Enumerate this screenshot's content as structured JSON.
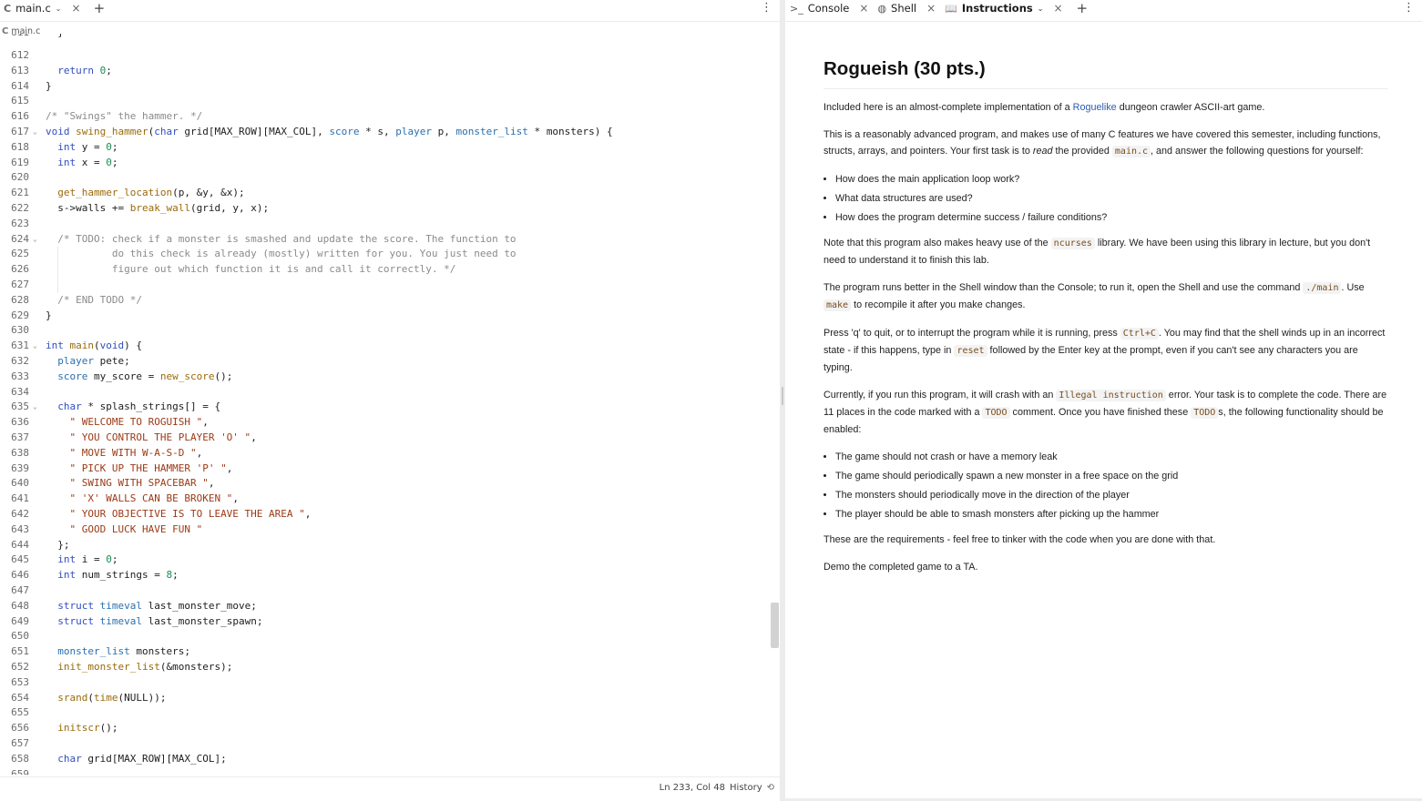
{
  "editor": {
    "tab_label": "main.c",
    "breadcrumb": "main.c",
    "status_position": "Ln 233, Col 48",
    "history_label": "History",
    "partial_line_top": "611",
    "partial_line_bottom": "659",
    "lines": [
      {
        "n": "612",
        "fold": "",
        "text": ""
      },
      {
        "n": "613",
        "fold": "",
        "text": "  return 0;"
      },
      {
        "n": "614",
        "fold": "",
        "text": "}"
      },
      {
        "n": "615",
        "fold": "",
        "text": ""
      },
      {
        "n": "616",
        "fold": "",
        "text": "/* \"Swings\" the hammer. */"
      },
      {
        "n": "617",
        "fold": "v",
        "text": "void swing_hammer(char grid[MAX_ROW][MAX_COL], score * s, player p, monster_list * monsters) {"
      },
      {
        "n": "618",
        "fold": "",
        "text": "  int y = 0;"
      },
      {
        "n": "619",
        "fold": "",
        "text": "  int x = 0;"
      },
      {
        "n": "620",
        "fold": "",
        "text": ""
      },
      {
        "n": "621",
        "fold": "",
        "text": "  get_hammer_location(p, &y, &x);"
      },
      {
        "n": "622",
        "fold": "",
        "text": "  s->walls += break_wall(grid, y, x);"
      },
      {
        "n": "623",
        "fold": "",
        "text": ""
      },
      {
        "n": "624",
        "fold": "v",
        "text": "  /* TODO: check if a monster is smashed and update the score. The function to"
      },
      {
        "n": "625",
        "fold": "",
        "text": "           do this check is already (mostly) written for you. You just need to"
      },
      {
        "n": "626",
        "fold": "",
        "text": "           figure out which function it is and call it correctly. */"
      },
      {
        "n": "627",
        "fold": "",
        "text": ""
      },
      {
        "n": "628",
        "fold": "",
        "text": "  /* END TODO */"
      },
      {
        "n": "629",
        "fold": "",
        "text": "}"
      },
      {
        "n": "630",
        "fold": "",
        "text": ""
      },
      {
        "n": "631",
        "fold": "v",
        "text": "int main(void) {"
      },
      {
        "n": "632",
        "fold": "",
        "text": "  player pete;"
      },
      {
        "n": "633",
        "fold": "",
        "text": "  score my_score = new_score();"
      },
      {
        "n": "634",
        "fold": "",
        "text": ""
      },
      {
        "n": "635",
        "fold": "v",
        "text": "  char * splash_strings[] = {"
      },
      {
        "n": "636",
        "fold": "",
        "text": "    \" WELCOME TO ROGUISH \","
      },
      {
        "n": "637",
        "fold": "",
        "text": "    \" YOU CONTROL THE PLAYER 'O' \","
      },
      {
        "n": "638",
        "fold": "",
        "text": "    \" MOVE WITH W-A-S-D \","
      },
      {
        "n": "639",
        "fold": "",
        "text": "    \" PICK UP THE HAMMER 'P' \","
      },
      {
        "n": "640",
        "fold": "",
        "text": "    \" SWING WITH SPACEBAR \","
      },
      {
        "n": "641",
        "fold": "",
        "text": "    \" 'X' WALLS CAN BE BROKEN \","
      },
      {
        "n": "642",
        "fold": "",
        "text": "    \" YOUR OBJECTIVE IS TO LEAVE THE AREA \","
      },
      {
        "n": "643",
        "fold": "",
        "text": "    \" GOOD LUCK HAVE FUN \""
      },
      {
        "n": "644",
        "fold": "",
        "text": "  };"
      },
      {
        "n": "645",
        "fold": "",
        "text": "  int i = 0;"
      },
      {
        "n": "646",
        "fold": "",
        "text": "  int num_strings = 8;"
      },
      {
        "n": "647",
        "fold": "",
        "text": ""
      },
      {
        "n": "648",
        "fold": "",
        "text": "  struct timeval last_monster_move;"
      },
      {
        "n": "649",
        "fold": "",
        "text": "  struct timeval last_monster_spawn;"
      },
      {
        "n": "650",
        "fold": "",
        "text": ""
      },
      {
        "n": "651",
        "fold": "",
        "text": "  monster_list monsters;"
      },
      {
        "n": "652",
        "fold": "",
        "text": "  init_monster_list(&monsters);"
      },
      {
        "n": "653",
        "fold": "",
        "text": ""
      },
      {
        "n": "654",
        "fold": "",
        "text": "  srand(time(NULL));"
      },
      {
        "n": "655",
        "fold": "",
        "text": ""
      },
      {
        "n": "656",
        "fold": "",
        "text": "  initscr();"
      },
      {
        "n": "657",
        "fold": "",
        "text": ""
      },
      {
        "n": "658",
        "fold": "",
        "text": "  char grid[MAX_ROW][MAX_COL];"
      }
    ]
  },
  "right_tabs": {
    "console": "Console",
    "shell": "Shell",
    "instructions": "Instructions"
  },
  "doc": {
    "title": "Rogueish (30 pts.)",
    "p1_a": "Included here is an almost-complete implementation of a ",
    "p1_link": "Roguelike",
    "p1_b": " dungeon crawler ASCII-art game.",
    "p2_a": "This is a reasonably advanced program, and makes use of many C features we have covered this semester, including functions, structs, arrays, and pointers. Your first task is to ",
    "p2_em": "read",
    "p2_b": " the provided ",
    "p2_code": "main.c",
    "p2_c": ", and answer the following questions for yourself:",
    "q1": "How does the main application loop work?",
    "q2": "What data structures are used?",
    "q3": "How does the program determine success / failure conditions?",
    "p3_a": "Note that this program also makes heavy use of the ",
    "p3_code": "ncurses",
    "p3_b": " library. We have been using this library in lecture, but you don't need to understand it to finish this lab.",
    "p4_a": "The program runs better in the Shell window than the Console; to run it, open the Shell and use the command ",
    "p4_code1": "./main",
    "p4_b": ". Use ",
    "p4_code2": "make",
    "p4_c": " to recompile it after you make changes.",
    "p5_a": "Press 'q' to quit, or to interrupt the program while it is running, press ",
    "p5_code1": "Ctrl+C",
    "p5_b": ". You may find that the shell winds up in an incorrect state - if this happens, type in ",
    "p5_code2": "reset",
    "p5_c": " followed by the Enter key at the prompt, even if you can't see any characters you are typing.",
    "p6_a": "Currently, if you run this program, it will crash with an ",
    "p6_code1": "Illegal instruction",
    "p6_b": " error. Your task is to complete the code. There are 11 places in the code marked with a ",
    "p6_code2": "TODO",
    "p6_c": " comment. Once you have finished these ",
    "p6_code3": "TODO",
    "p6_d": "s, the following functionality should be enabled:",
    "r1": "The game should not crash or have a memory leak",
    "r2": "The game should periodically spawn a new monster in a free space on the grid",
    "r3": "The monsters should periodically move in the direction of the player",
    "r4": "The player should be able to smash monsters after picking up the hammer",
    "p7": "These are the requirements - feel free to tinker with the code when you are done with that.",
    "p8": "Demo the completed game to a TA."
  }
}
